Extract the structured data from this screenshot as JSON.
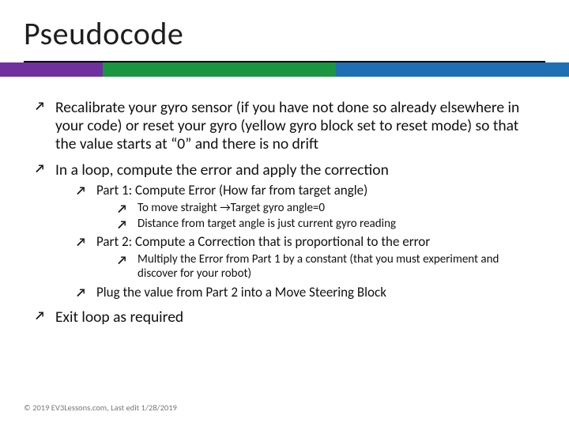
{
  "title": "Pseudocode",
  "bullets": {
    "b1": "Recalibrate your gyro sensor (if you have not done so already elsewhere in your code) or reset your gyro (yellow gyro block set to reset mode) so that the value starts at “0” and there is no drift",
    "b2": "In a loop, compute the error and apply the correction",
    "b2_1": "Part 1: Compute Error (How far from target angle)",
    "b2_1_a_pre": "To move straight",
    "b2_1_a_post": "Target gyro angle=0",
    "b2_1_b": "Distance from target angle is just current gyro reading",
    "b2_2": "Part 2: Compute a Correction that is proportional to the error",
    "b2_2_a": "Multiply the Error from Part 1 by a constant (that you must experiment and discover for your robot)",
    "b2_3": "Plug the value from Part 2 into a Move Steering Block",
    "b3": "Exit loop as required"
  },
  "footer": "© 2019 EV3Lessons.com, Last edit 1/28/2019"
}
